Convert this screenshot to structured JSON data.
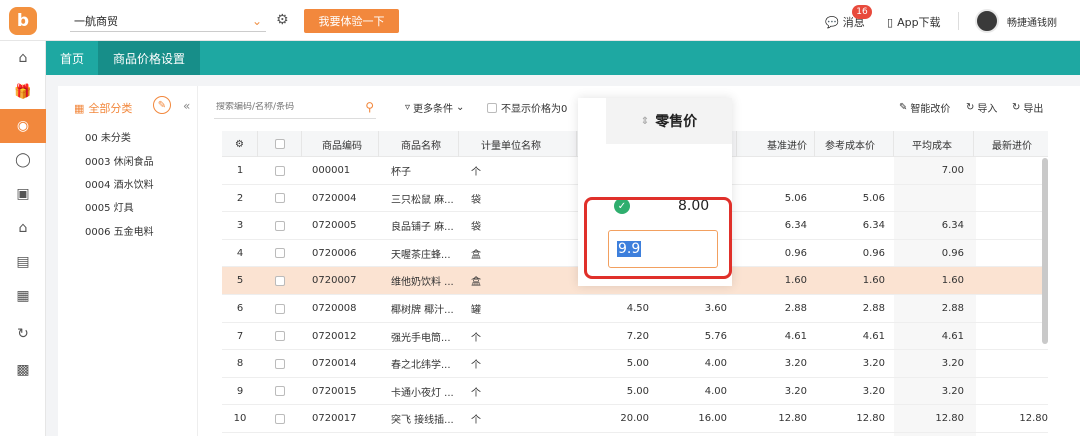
{
  "header": {
    "logo_text": "b",
    "store_name": "一航商贸",
    "trial_button": "我要体验一下",
    "messages_label": "消息",
    "messages_badge": "16",
    "app_download": "App下载",
    "username": "畅捷通钱刚"
  },
  "rail": {
    "icons": [
      "home-icon",
      "gift-icon",
      "price-settings-icon",
      "moneybag-icon",
      "shopping-bag-icon",
      "store-icon",
      "clipboard-icon",
      "report-icon",
      "sync-icon",
      "list-icon"
    ],
    "active_index": 2
  },
  "tabs": [
    {
      "label": "首页",
      "active": false
    },
    {
      "label": "商品价格设置",
      "active": true
    }
  ],
  "category": {
    "header": "全部分类",
    "items": [
      "00 未分类",
      "0003 休闲食品",
      "0004 酒水饮料",
      "0005 灯具",
      "0006 五金电料"
    ]
  },
  "toolbar": {
    "search_placeholder": "搜索编码/名称/条码",
    "more_conditions": "更多条件",
    "hide_zero_price": "不显示价格为0",
    "smart_price": "智能改价",
    "import": "导入",
    "export": "导出"
  },
  "table": {
    "headers": {
      "code": "商品编码",
      "name": "商品名称",
      "unit": "计量单位名称",
      "base_purchase": "基准进价",
      "ref_cost": "参考成本价",
      "avg_cost": "平均成本",
      "latest_purchase": "最新进价"
    },
    "rows": [
      {
        "no": "1",
        "code": "000001",
        "name": "杯子",
        "unit": "个",
        "retail": "",
        "p2": "",
        "base": "",
        "ref": "",
        "avg": "7.00",
        "latest": ""
      },
      {
        "no": "2",
        "code": "0720004",
        "name": "三只松鼠 麻...",
        "unit": "袋",
        "retail": "",
        "p2": "",
        "base": "5.06",
        "ref": "5.06",
        "avg": "",
        "latest": ""
      },
      {
        "no": "3",
        "code": "0720005",
        "name": "良品铺子 麻...",
        "unit": "袋",
        "retail": "",
        "p2": "",
        "base": "6.34",
        "ref": "6.34",
        "avg": "6.34",
        "latest": ""
      },
      {
        "no": "4",
        "code": "0720006",
        "name": "天喔茶庄蜂...",
        "unit": "盒",
        "retail": "",
        "p2": "",
        "base": "0.96",
        "ref": "0.96",
        "avg": "0.96",
        "latest": ""
      },
      {
        "no": "5",
        "code": "0720007",
        "name": "维他奶饮料 ...",
        "unit": "盒",
        "retail": "",
        "p2": "",
        "base": "1.60",
        "ref": "1.60",
        "avg": "1.60",
        "latest": ""
      },
      {
        "no": "6",
        "code": "0720008",
        "name": "椰树牌 椰汁...",
        "unit": "罐",
        "retail": "4.50",
        "p2": "3.60",
        "base": "2.88",
        "ref": "2.88",
        "avg": "2.88",
        "latest": ""
      },
      {
        "no": "7",
        "code": "0720012",
        "name": "强光手电筒...",
        "unit": "个",
        "retail": "7.20",
        "p2": "5.76",
        "base": "4.61",
        "ref": "4.61",
        "avg": "4.61",
        "latest": ""
      },
      {
        "no": "8",
        "code": "0720014",
        "name": "春之北纬学...",
        "unit": "个",
        "retail": "5.00",
        "p2": "4.00",
        "base": "3.20",
        "ref": "3.20",
        "avg": "3.20",
        "latest": ""
      },
      {
        "no": "9",
        "code": "0720015",
        "name": "卡通小夜灯 ...",
        "unit": "个",
        "retail": "5.00",
        "p2": "4.00",
        "base": "3.20",
        "ref": "3.20",
        "avg": "3.20",
        "latest": ""
      },
      {
        "no": "10",
        "code": "0720017",
        "name": "突飞 接线插...",
        "unit": "个",
        "retail": "20.00",
        "p2": "16.00",
        "base": "12.80",
        "ref": "12.80",
        "avg": "12.80",
        "latest": "12.80"
      }
    ],
    "selected_row": 5
  },
  "popup": {
    "column_title": "零售价",
    "old_value": "8.00",
    "edit_value": "9.9"
  },
  "colors": {
    "accent": "#f2883d",
    "teal": "#1ea8a2",
    "highlight_row": "#fbe3d2",
    "red_box": "#e0302a"
  }
}
